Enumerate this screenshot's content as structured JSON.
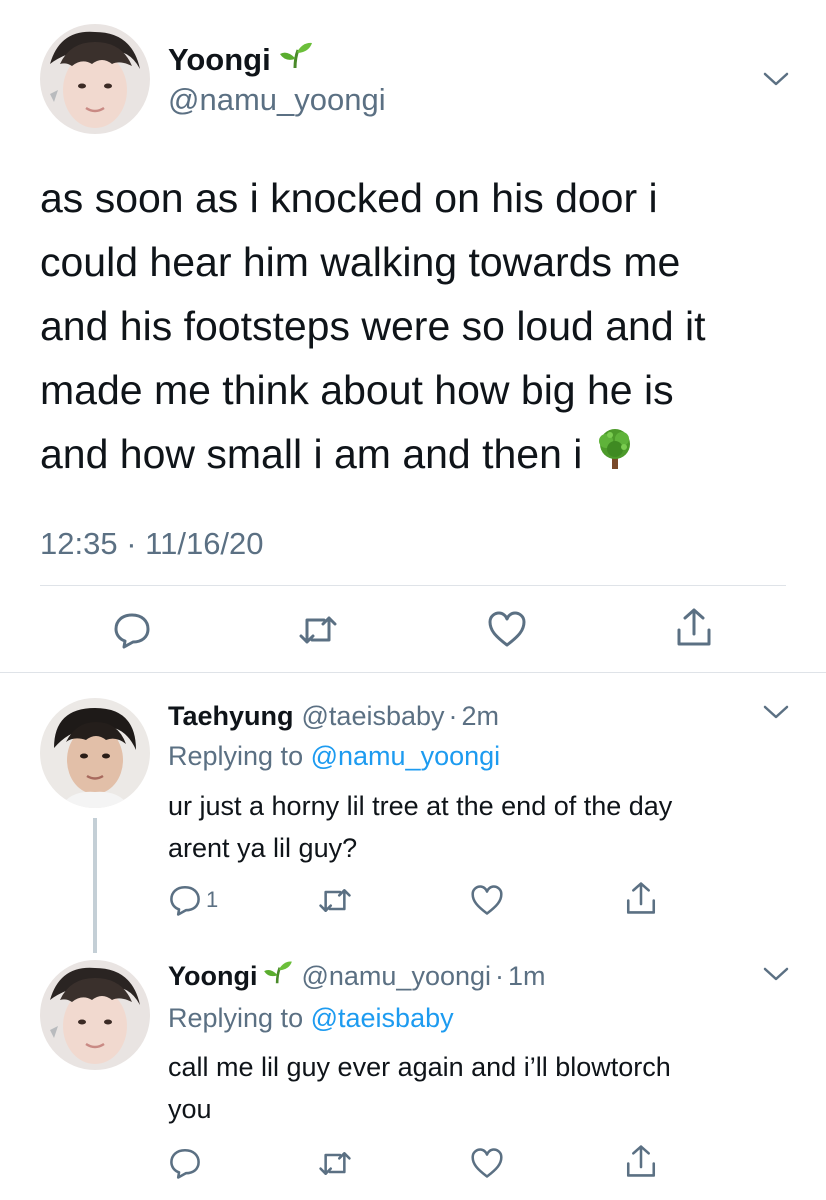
{
  "main_tweet": {
    "display_name": "Yoongi",
    "name_emoji": "seedling-emoji",
    "handle": "@namu_yoongi",
    "text_lines": [
      "as soon as i knocked on his door i",
      "could hear him walking towards me",
      "and his footsteps were so loud and it",
      "made me think about how big he is",
      "and how small i am and then i"
    ],
    "text_end_emoji": "deciduous-tree-emoji",
    "time": "12:35",
    "separator": "·",
    "date": "11/16/20"
  },
  "replies": [
    {
      "display_name": "Taehyung",
      "handle": "@taeisbaby",
      "separator": "·",
      "age": "2m",
      "replying_prefix": "Replying to",
      "replying_to": "@namu_yoongi",
      "text_lines": [
        "ur just a horny lil tree at the end of the day",
        "arent ya lil guy?"
      ],
      "reply_count": "1"
    },
    {
      "display_name": "Yoongi",
      "name_emoji": "seedling-emoji",
      "handle": "@namu_yoongi",
      "separator": "·",
      "age": "1m",
      "replying_prefix": "Replying to",
      "replying_to": "@taeisbaby",
      "text_lines": [
        "call me lil guy ever again and i’ll blowtorch",
        "you"
      ]
    }
  ],
  "colors": {
    "text": "#0f1419",
    "muted": "#5b7083",
    "link": "#1d9bf0",
    "divider": "#dfe3e8",
    "thread_line": "#c4cfd6"
  }
}
